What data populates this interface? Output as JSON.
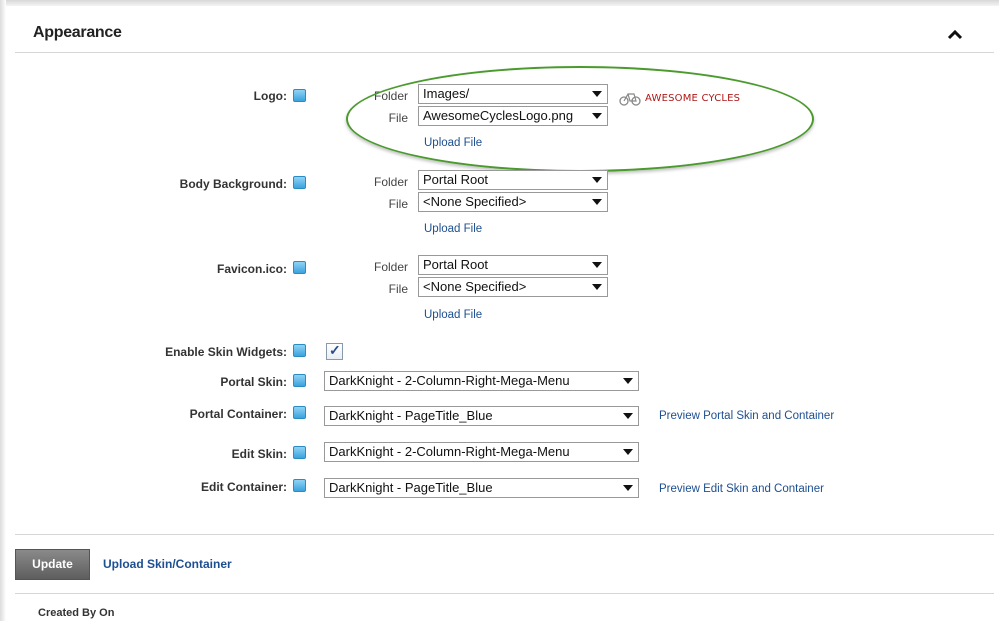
{
  "section": {
    "title": "Appearance"
  },
  "logo": {
    "label": "Logo:",
    "folder_label": "Folder",
    "folder_value": "Images/",
    "file_label": "File",
    "file_value": "AwesomeCyclesLogo.png",
    "upload_label": "Upload File",
    "preview_text": "AWESOME CYCLES"
  },
  "body_background": {
    "label": "Body Background:",
    "folder_label": "Folder",
    "folder_value": "Portal Root",
    "file_label": "File",
    "file_value": "<None Specified>",
    "upload_label": "Upload File"
  },
  "favicon": {
    "label": "Favicon.ico:",
    "folder_label": "Folder",
    "folder_value": "Portal Root",
    "file_label": "File",
    "file_value": "<None Specified>",
    "upload_label": "Upload File"
  },
  "skin_widgets": {
    "label": "Enable Skin Widgets:",
    "checked": true,
    "check_glyph": "✓"
  },
  "portal_skin": {
    "label": "Portal Skin:",
    "value": "DarkKnight - 2-Column-Right-Mega-Menu"
  },
  "portal_container": {
    "label": "Portal Container:",
    "value": "DarkKnight - PageTitle_Blue",
    "preview_link": "Preview Portal Skin and Container"
  },
  "edit_skin": {
    "label": "Edit Skin:",
    "value": "DarkKnight - 2-Column-Right-Mega-Menu"
  },
  "edit_container": {
    "label": "Edit Container:",
    "value": "DarkKnight - PageTitle_Blue",
    "preview_link": "Preview Edit Skin and Container"
  },
  "actions": {
    "update_label": "Update",
    "upload_skin_label": "Upload Skin/Container"
  },
  "footer": {
    "created_label": "Created By On"
  },
  "colors": {
    "link": "#1d4f91",
    "highlight": "#4a9a2e",
    "logo_text": "#b01818",
    "help_icon": "#3ba3de"
  },
  "icons": {
    "collapse": "chevron-up-icon",
    "help": "help-icon",
    "logo": "bicycle-icon"
  }
}
